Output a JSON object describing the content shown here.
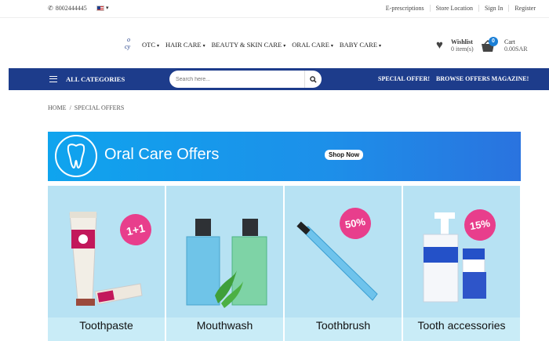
{
  "topbar": {
    "phone": "8002444445",
    "links": [
      "E-prescriptions",
      "Store Location",
      "Sign In",
      "Register"
    ]
  },
  "header": {
    "logo_fragment_1": "o",
    "logo_fragment_2": "cy",
    "nav": [
      "OTC",
      "HAIR CARE",
      "BEAUTY & SKIN CARE",
      "ORAL CARE",
      "BABY CARE"
    ],
    "wishlist": {
      "label": "Wishlist",
      "count": "0 item(s)"
    },
    "cart": {
      "label": "Cart",
      "badge": "0",
      "total": "0.00SAR"
    }
  },
  "navbar": {
    "all_categories": "ALL CATEGORIES",
    "search_placeholder": "Search here...",
    "special_offer": "SPECIAL OFFER!",
    "browse_magazine": "BROWSE OFFERS MAGAZINE!"
  },
  "breadcrumb": {
    "home": "HOME",
    "sep": "/",
    "current": "SPECIAL OFFERS"
  },
  "banner": {
    "title": "Oral Care Offers",
    "button": "Shop Now"
  },
  "tiles": [
    {
      "label": "Toothpaste",
      "badge": "1+1"
    },
    {
      "label": "Mouthwash"
    },
    {
      "label": "Toothbrush",
      "badge": "50%"
    },
    {
      "label": "Tooth accessories",
      "badge": "15%"
    }
  ],
  "colors": {
    "navbar": "#1d3c8b",
    "banner": "#0fa4ee",
    "tile": "#b7e2f3",
    "badge": "#e83e8c"
  }
}
